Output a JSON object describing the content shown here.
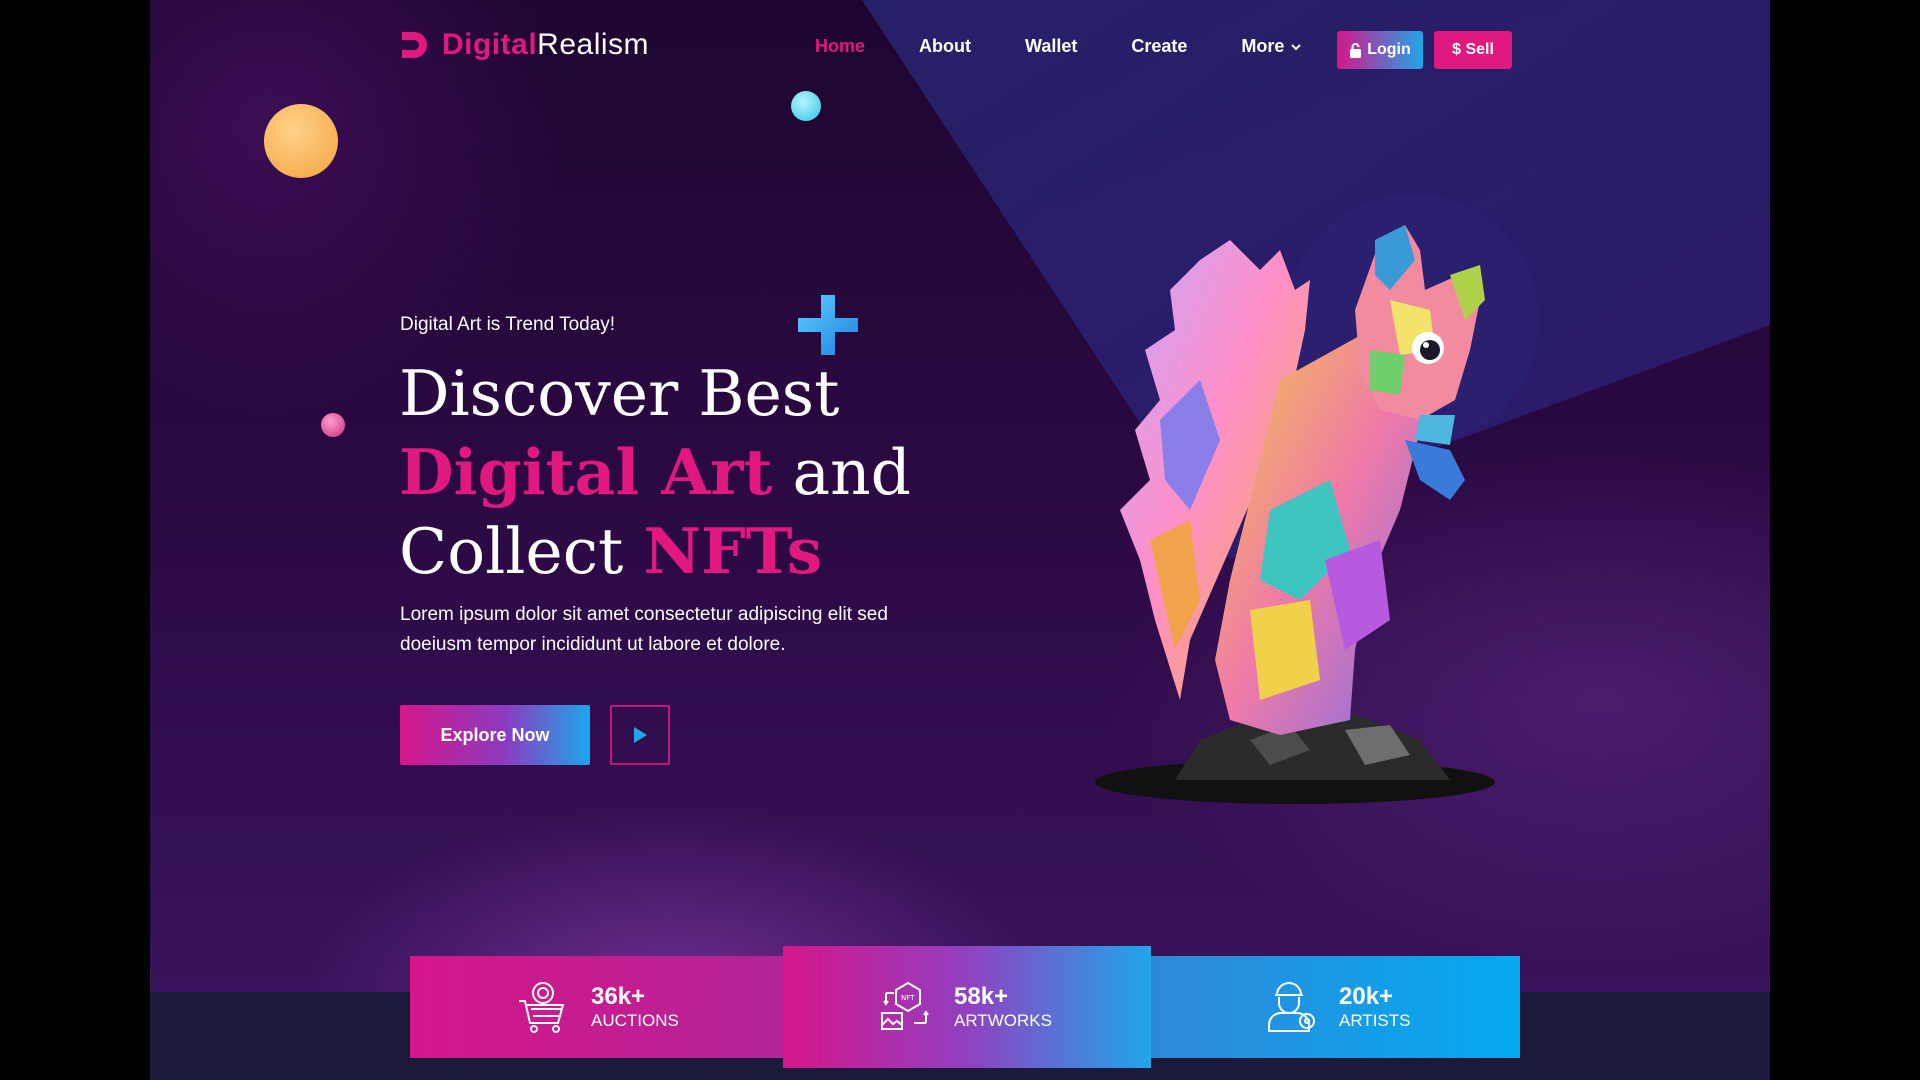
{
  "brand": {
    "name_part1": "Digital",
    "name_part2": "Realism",
    "accent": "#e0187f",
    "secondary": "#1fa6ea"
  },
  "nav": {
    "items": [
      {
        "label": "Home",
        "active": true
      },
      {
        "label": "About"
      },
      {
        "label": "Wallet"
      },
      {
        "label": "Create"
      },
      {
        "label": "More",
        "icon": "chevron-down-icon"
      }
    ],
    "login_label": "Login",
    "login_icon": "lock-icon",
    "sell_label": "$ Sell"
  },
  "hero": {
    "tagline": "Digital Art is Trend Today!",
    "headline_line1": "Discover Best",
    "headline_accent1": "Digital Art",
    "headline_mid": "and",
    "headline_line3": "Collect",
    "headline_accent2": "NFTs",
    "description": "Lorem ipsum dolor sit amet consectetur adipiscing elit sed doeiusm tempor incididunt ut labore et dolore.",
    "cta_label": "Explore Now",
    "play_icon": "play-icon",
    "art": "polygonal-squirrel-illustration"
  },
  "stats": [
    {
      "value": "36k+",
      "label": "AUCTIONS",
      "icon": "auction-cart-icon"
    },
    {
      "value": "58k+",
      "label": "ARTWORKS",
      "icon": "nft-artwork-icon"
    },
    {
      "value": "20k+",
      "label": "ARTISTS",
      "icon": "artist-icon"
    }
  ]
}
